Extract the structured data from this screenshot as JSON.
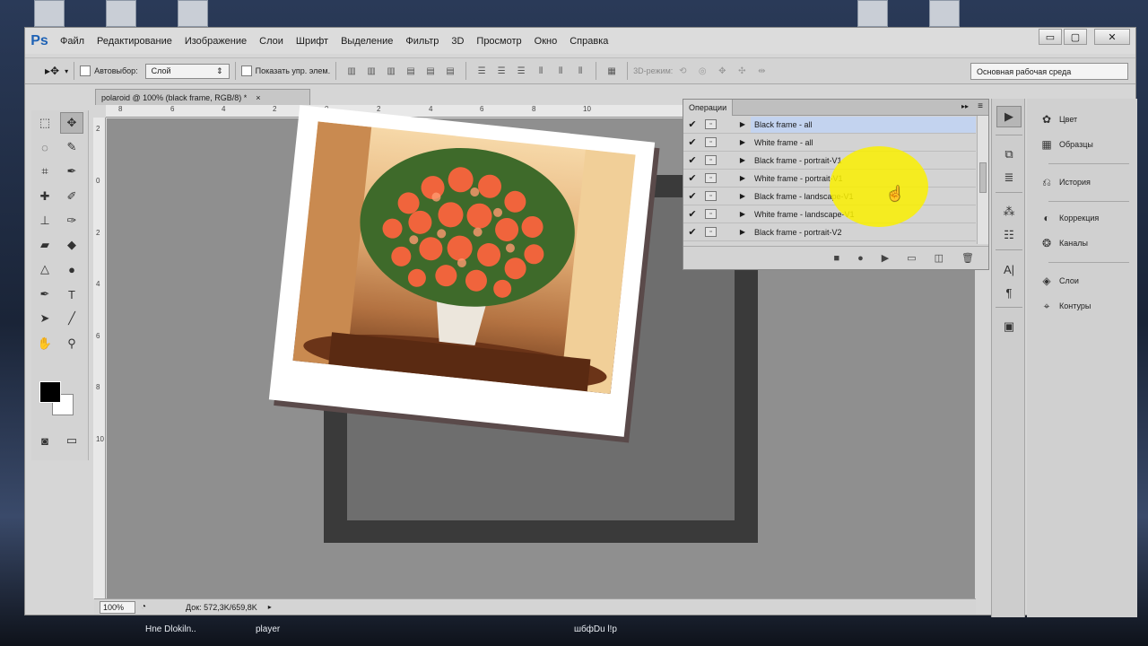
{
  "desktop": {
    "bottom_labels": [
      "Hne Dlokiln..",
      "player",
      "шбфDu l!р"
    ]
  },
  "menubar": {
    "logo": "Ps",
    "items": [
      "Файл",
      "Редактирование",
      "Изображение",
      "Слои",
      "Шрифт",
      "Выделение",
      "Фильтр",
      "3D",
      "Просмотр",
      "Окно",
      "Справка"
    ],
    "window_controls": [
      "▭",
      "▢",
      "✕"
    ]
  },
  "options_bar": {
    "tool_icon": "move-tool-icon",
    "auto_select_label": "Автовыбор:",
    "auto_select_value": "Слой",
    "show_controls_label": "Показать упр. элем.",
    "mode_3d_label": "3D-режим:",
    "workspace": "Основная рабочая среда"
  },
  "document": {
    "tab_title": "polaroid @ 100% (black frame, RGB/8) *",
    "ruler_h_ticks": [
      "8",
      "6",
      "4",
      "2",
      "0",
      "2",
      "4",
      "6",
      "8",
      "10"
    ],
    "ruler_v_ticks": [
      "2",
      "0",
      "2",
      "4",
      "6",
      "8",
      "10"
    ],
    "zoom": "100%",
    "doc_info": "Док: 572,3K/659,8K"
  },
  "actions_panel": {
    "tab": "Операции",
    "rows": [
      {
        "label": "Black frame - all",
        "selected": true
      },
      {
        "label": "White frame - all",
        "selected": false
      },
      {
        "label": "Black frame - portrait-V1",
        "selected": false
      },
      {
        "label": "White frame - portrait-V1",
        "selected": false
      },
      {
        "label": "Black frame - landscape-V1",
        "selected": false
      },
      {
        "label": "White frame - landscape-V1",
        "selected": false
      },
      {
        "label": "Black frame - portrait-V2",
        "selected": false
      }
    ],
    "footer_icons": [
      "stop-icon",
      "record-icon",
      "play-icon",
      "new-set-icon",
      "new-action-icon",
      "trash-icon"
    ]
  },
  "right_panel": {
    "items": [
      "Цвет",
      "Образцы",
      "История",
      "Коррекция",
      "Каналы",
      "Слои",
      "Контуры"
    ]
  },
  "colors": {
    "accent": "#1e62b5",
    "selected_row": "#c3d3ef",
    "highlight": "#faf000"
  }
}
